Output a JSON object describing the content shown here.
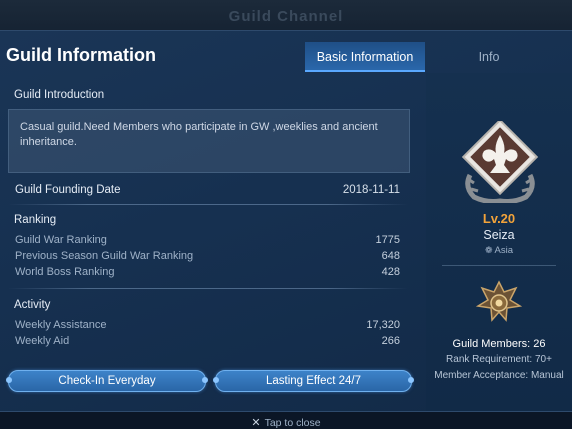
{
  "background_title": "Guild Channel",
  "panel": {
    "title": "Guild Information",
    "tabs": [
      {
        "label": "Basic Information",
        "active": true
      },
      {
        "label": "Info",
        "active": false
      }
    ]
  },
  "introduction": {
    "label": "Guild Introduction",
    "text": "Casual guild.Need Members who participate in GW ,weeklies and ancient inheritance."
  },
  "founding": {
    "label": "Guild Founding Date",
    "value": "2018-11-11"
  },
  "ranking": {
    "label": "Ranking",
    "rows": [
      {
        "label": "Guild War Ranking",
        "value": "1775"
      },
      {
        "label": "Previous Season Guild War Ranking",
        "value": "648"
      },
      {
        "label": "World Boss Ranking",
        "value": "428"
      }
    ]
  },
  "activity": {
    "label": "Activity",
    "rows": [
      {
        "label": "Weekly Assistance",
        "value": "17,320"
      },
      {
        "label": "Weekly Aid",
        "value": "266"
      }
    ]
  },
  "buttons": {
    "checkin": "Check-In Everyday",
    "effect": "Lasting Effect 24/7"
  },
  "guild": {
    "level": "Lv.20",
    "name": "Seiza",
    "region": "Asia",
    "emblem_icon": "fleur-de-lis-emblem-icon",
    "crest_icon": "guild-rank-crest-icon",
    "members": "Guild Members: 26",
    "rank_requirement": "Rank Requirement: 70+",
    "member_acceptance": "Member Acceptance: Manual"
  },
  "footer": {
    "tap_to_close": "Tap to close"
  },
  "colors": {
    "accent_level": "#f2a33a",
    "active_tab": "#2a67ab",
    "button": "#3577bb"
  }
}
